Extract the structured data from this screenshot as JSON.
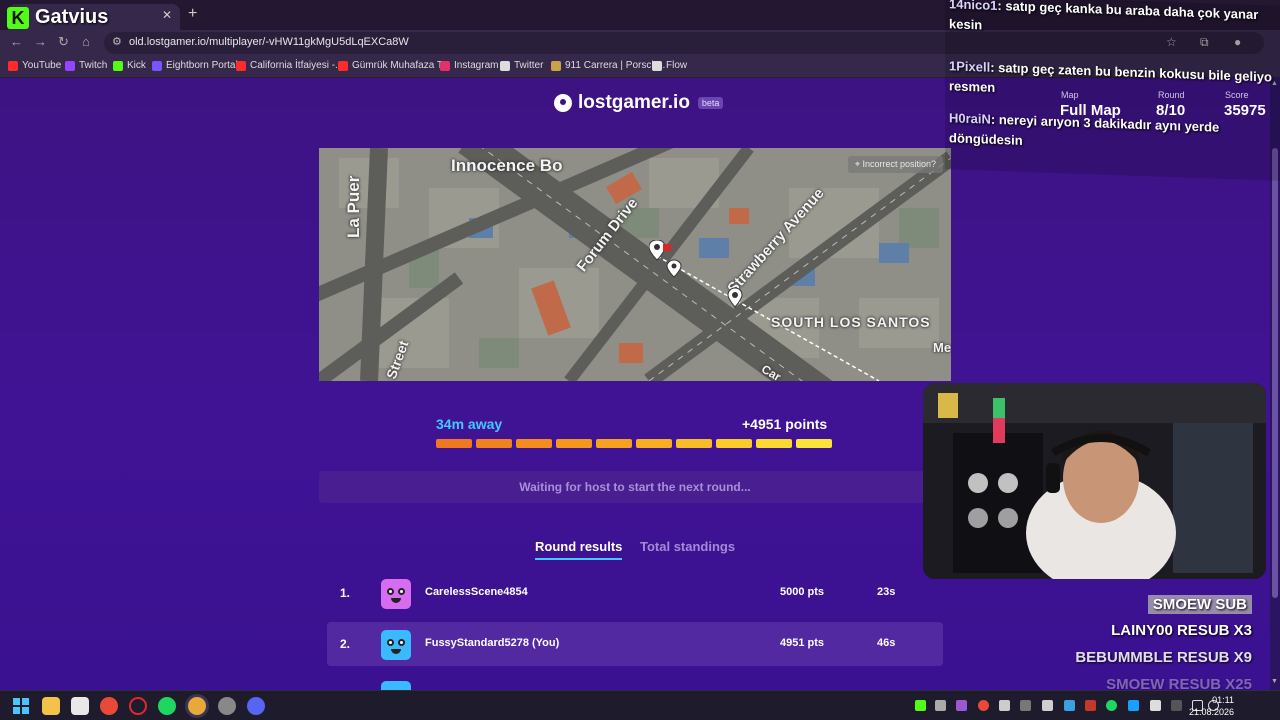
{
  "browser": {
    "tab_title": "Gatvius",
    "url": "old.lostgamer.io/multiplayer/-vHW11gkMgU5dLqEXCa8W",
    "bookmarks": [
      {
        "label": "YouTube",
        "color": "#ff2b2b"
      },
      {
        "label": "Twitch",
        "color": "#9146ff"
      },
      {
        "label": "Kick",
        "color": "#53fc18"
      },
      {
        "label": "Eightborn Portal",
        "color": "#7a52ff"
      },
      {
        "label": "California İtfaiyesi -...",
        "color": "#ff2b2b"
      },
      {
        "label": "Gümrük Muhafaza T...",
        "color": "#ff2b2b"
      },
      {
        "label": "Instagram",
        "color": "#e1306c"
      },
      {
        "label": "Twitter",
        "color": "#dddddd"
      },
      {
        "label": "911 Carrera | Porsch...",
        "color": "#c9a24b"
      },
      {
        "label": "Flow",
        "color": "#dddddd"
      }
    ]
  },
  "site": {
    "logo_text": "lostgamer.io",
    "beta": "beta"
  },
  "map": {
    "incorrect_label": "Incorrect position?",
    "labels": [
      "Innocence Bo",
      "La Puer",
      "Forum Drive",
      "Strawberry Avenue",
      "SOUTH LOS SANTOS",
      "a Street",
      "Car",
      "Me"
    ]
  },
  "result": {
    "distance": "34m away",
    "points": "+4951 points",
    "score_fraction": 1.0,
    "segment_colors": [
      "#f07820",
      "#f2821f",
      "#f48c1f",
      "#f5961f",
      "#f6a220",
      "#f7ae22",
      "#f8bd26",
      "#f9cc2a",
      "#fad930",
      "#fbe43a"
    ]
  },
  "waiting_text": "Waiting for host to start the next round...",
  "tabs": {
    "round": "Round results",
    "total": "Total standings"
  },
  "rows": [
    {
      "rank": "1.",
      "name": "CarelessScene4854",
      "points": "5000 pts",
      "time": "23s",
      "avatar": "#d66cf0"
    },
    {
      "rank": "2.",
      "name": "FussyStandard5278 (You)",
      "points": "4951 pts",
      "time": "46s",
      "avatar": "#3ab9ff"
    }
  ],
  "stream": {
    "kick_logo": "K",
    "streamer": "Gatvius",
    "chat": [
      {
        "user": "14nico1",
        "text": ": satıp geç kanka bu araba daha çok yanar kesin"
      },
      {
        "user": "1Pixell",
        "text": ": satıp geç zaten bu benzin kokusu bile geliyo resmen"
      },
      {
        "user": "H0raiN",
        "text": ": nereyi arıyon 3 dakikadır aynı yerde döngüdesin"
      }
    ],
    "hud": {
      "map_label": "Map",
      "map_value": "Full Map",
      "round_label": "Round",
      "round_value": "8/10",
      "score_label": "Score",
      "score_value": "35975"
    },
    "subs": [
      "SMOEW  SUB",
      "LAINY00  RESUB X3",
      "BEBUMMBLE  RESUB X9",
      "SMOEW  RESUB X25"
    ]
  },
  "taskbar": {
    "time": "01:11",
    "date": "21.08.2026"
  }
}
